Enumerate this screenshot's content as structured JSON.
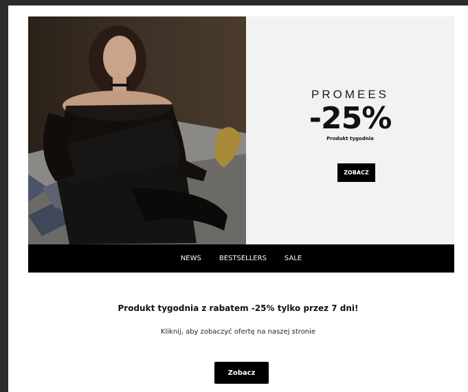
{
  "hero": {
    "image": {
      "alt_icon": "model-photo"
    },
    "promo": {
      "brand": "PROMEES",
      "discount": "-25%",
      "label": "Produkt tygodnia",
      "button_label": "ZOBACZ"
    }
  },
  "nav": {
    "items": [
      {
        "label": "NEWS"
      },
      {
        "label": "BESTSELLERS"
      },
      {
        "label": "SALE"
      }
    ]
  },
  "body": {
    "headline": "Produkt tygodnia z rabatem -25% tylko przez 7 dni!",
    "subline": "Kliknij, aby zobaczyć ofertę na naszej stronie",
    "cta_label": "Zobacz"
  },
  "colors": {
    "page_bg": "#2b2b29",
    "promo_bg": "#f2f2f2",
    "accent": "#000000"
  }
}
